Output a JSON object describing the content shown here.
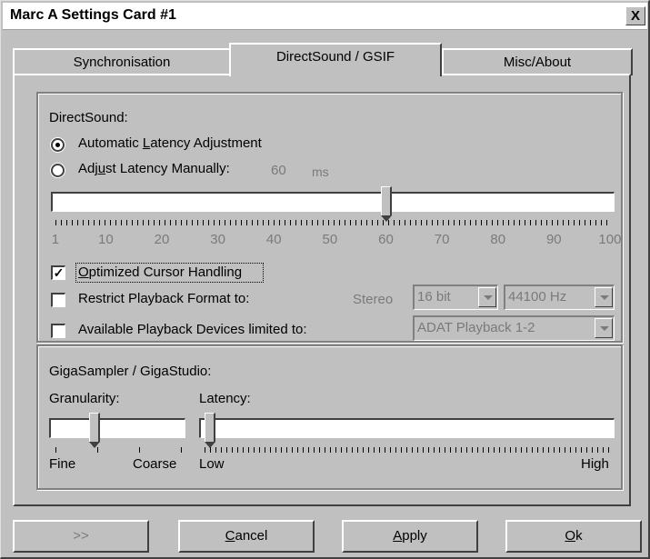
{
  "window": {
    "title": "Marc A Settings Card #1",
    "close_label": "X"
  },
  "tabs": [
    {
      "label": "Synchronisation"
    },
    {
      "label": "DirectSound / GSIF"
    },
    {
      "label": "Misc/About"
    }
  ],
  "directsound": {
    "group_label": "DirectSound:",
    "auto_latency": {
      "pre": "Automatic ",
      "ul": "L",
      "post": "atency Adjustment",
      "selected": true
    },
    "manual_latency": {
      "pre": "Adj",
      "ul": "u",
      "post": "st Latency Manually:",
      "selected": false
    },
    "latency_value": "60",
    "latency_unit": "ms",
    "slider": {
      "min": 1,
      "max": 100,
      "value": 60,
      "tick_labels": [
        "1",
        "10",
        "20",
        "30",
        "40",
        "50",
        "60",
        "70",
        "80",
        "90",
        "100"
      ]
    },
    "optimized_cursor": {
      "ul": "O",
      "post": "ptimized Cursor Handling",
      "checked": true
    },
    "restrict_format": {
      "label": "Restrict Playback Format to:",
      "checked": false
    },
    "stereo_label": "Stereo",
    "bit_depth": "16 bit",
    "sample_rate": "44100 Hz",
    "limit_devices": {
      "label": "Available Playback Devices limited to:",
      "checked": false
    },
    "device": "ADAT Playback 1-2"
  },
  "giga": {
    "group_label": "GigaSampler / GigaStudio:",
    "granularity": {
      "label": "Granularity:",
      "min_label": "Fine",
      "max_label": "Coarse",
      "value_fraction": 0.3
    },
    "latency": {
      "label": "Latency:",
      "min_label": "Low",
      "max_label": "High",
      "value_fraction": 0.0
    }
  },
  "buttons": {
    "prev": ">>",
    "cancel": {
      "ul": "C",
      "post": "ancel"
    },
    "apply": {
      "ul": "A",
      "post": "pply"
    },
    "ok": {
      "ul": "O",
      "post": "k"
    }
  }
}
